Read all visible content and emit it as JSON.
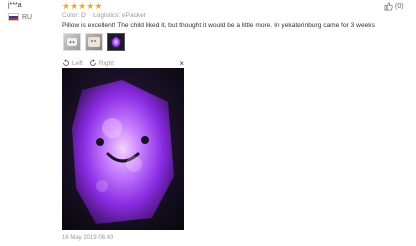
{
  "reviewer": {
    "name": "j***a",
    "country": "RU"
  },
  "rating": {
    "stars": 5
  },
  "meta": {
    "color_label": "Color:",
    "color_value": "D",
    "logistics_label": "Logistics:",
    "logistics_value": "ePacket"
  },
  "like": {
    "count": "(0)"
  },
  "review": {
    "text": "Pillow is excellent! The child liked it, but thought it would be a little more. In yekaterinburg came for 3 weeks"
  },
  "viewer": {
    "left_label": "Left",
    "right_label": "Right",
    "close_symbol": "×"
  },
  "date": "16 May 2019 06:43",
  "colors": {
    "star": "#f5a623",
    "glow": "#a24bff"
  }
}
